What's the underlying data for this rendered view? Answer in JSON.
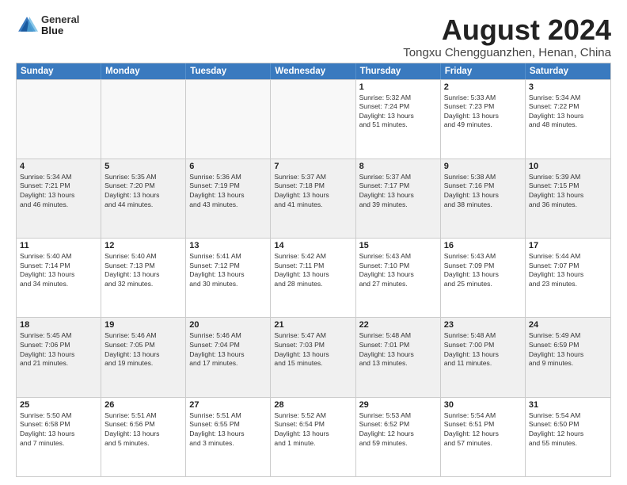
{
  "logo": {
    "line1": "General",
    "line2": "Blue"
  },
  "title": "August 2024",
  "location": "Tongxu Chengguanzhen, Henan, China",
  "header_days": [
    "Sunday",
    "Monday",
    "Tuesday",
    "Wednesday",
    "Thursday",
    "Friday",
    "Saturday"
  ],
  "rows": [
    [
      {
        "day": "",
        "empty": true
      },
      {
        "day": "",
        "empty": true
      },
      {
        "day": "",
        "empty": true
      },
      {
        "day": "",
        "empty": true
      },
      {
        "day": "1",
        "sunrise": "Sunrise: 5:32 AM",
        "sunset": "Sunset: 7:24 PM",
        "daylight": "Daylight: 13 hours",
        "daylight2": "and 51 minutes."
      },
      {
        "day": "2",
        "sunrise": "Sunrise: 5:33 AM",
        "sunset": "Sunset: 7:23 PM",
        "daylight": "Daylight: 13 hours",
        "daylight2": "and 49 minutes."
      },
      {
        "day": "3",
        "sunrise": "Sunrise: 5:34 AM",
        "sunset": "Sunset: 7:22 PM",
        "daylight": "Daylight: 13 hours",
        "daylight2": "and 48 minutes."
      }
    ],
    [
      {
        "day": "4",
        "sunrise": "Sunrise: 5:34 AM",
        "sunset": "Sunset: 7:21 PM",
        "daylight": "Daylight: 13 hours",
        "daylight2": "and 46 minutes."
      },
      {
        "day": "5",
        "sunrise": "Sunrise: 5:35 AM",
        "sunset": "Sunset: 7:20 PM",
        "daylight": "Daylight: 13 hours",
        "daylight2": "and 44 minutes."
      },
      {
        "day": "6",
        "sunrise": "Sunrise: 5:36 AM",
        "sunset": "Sunset: 7:19 PM",
        "daylight": "Daylight: 13 hours",
        "daylight2": "and 43 minutes."
      },
      {
        "day": "7",
        "sunrise": "Sunrise: 5:37 AM",
        "sunset": "Sunset: 7:18 PM",
        "daylight": "Daylight: 13 hours",
        "daylight2": "and 41 minutes."
      },
      {
        "day": "8",
        "sunrise": "Sunrise: 5:37 AM",
        "sunset": "Sunset: 7:17 PM",
        "daylight": "Daylight: 13 hours",
        "daylight2": "and 39 minutes."
      },
      {
        "day": "9",
        "sunrise": "Sunrise: 5:38 AM",
        "sunset": "Sunset: 7:16 PM",
        "daylight": "Daylight: 13 hours",
        "daylight2": "and 38 minutes."
      },
      {
        "day": "10",
        "sunrise": "Sunrise: 5:39 AM",
        "sunset": "Sunset: 7:15 PM",
        "daylight": "Daylight: 13 hours",
        "daylight2": "and 36 minutes."
      }
    ],
    [
      {
        "day": "11",
        "sunrise": "Sunrise: 5:40 AM",
        "sunset": "Sunset: 7:14 PM",
        "daylight": "Daylight: 13 hours",
        "daylight2": "and 34 minutes."
      },
      {
        "day": "12",
        "sunrise": "Sunrise: 5:40 AM",
        "sunset": "Sunset: 7:13 PM",
        "daylight": "Daylight: 13 hours",
        "daylight2": "and 32 minutes."
      },
      {
        "day": "13",
        "sunrise": "Sunrise: 5:41 AM",
        "sunset": "Sunset: 7:12 PM",
        "daylight": "Daylight: 13 hours",
        "daylight2": "and 30 minutes."
      },
      {
        "day": "14",
        "sunrise": "Sunrise: 5:42 AM",
        "sunset": "Sunset: 7:11 PM",
        "daylight": "Daylight: 13 hours",
        "daylight2": "and 28 minutes."
      },
      {
        "day": "15",
        "sunrise": "Sunrise: 5:43 AM",
        "sunset": "Sunset: 7:10 PM",
        "daylight": "Daylight: 13 hours",
        "daylight2": "and 27 minutes."
      },
      {
        "day": "16",
        "sunrise": "Sunrise: 5:43 AM",
        "sunset": "Sunset: 7:09 PM",
        "daylight": "Daylight: 13 hours",
        "daylight2": "and 25 minutes."
      },
      {
        "day": "17",
        "sunrise": "Sunrise: 5:44 AM",
        "sunset": "Sunset: 7:07 PM",
        "daylight": "Daylight: 13 hours",
        "daylight2": "and 23 minutes."
      }
    ],
    [
      {
        "day": "18",
        "sunrise": "Sunrise: 5:45 AM",
        "sunset": "Sunset: 7:06 PM",
        "daylight": "Daylight: 13 hours",
        "daylight2": "and 21 minutes."
      },
      {
        "day": "19",
        "sunrise": "Sunrise: 5:46 AM",
        "sunset": "Sunset: 7:05 PM",
        "daylight": "Daylight: 13 hours",
        "daylight2": "and 19 minutes."
      },
      {
        "day": "20",
        "sunrise": "Sunrise: 5:46 AM",
        "sunset": "Sunset: 7:04 PM",
        "daylight": "Daylight: 13 hours",
        "daylight2": "and 17 minutes."
      },
      {
        "day": "21",
        "sunrise": "Sunrise: 5:47 AM",
        "sunset": "Sunset: 7:03 PM",
        "daylight": "Daylight: 13 hours",
        "daylight2": "and 15 minutes."
      },
      {
        "day": "22",
        "sunrise": "Sunrise: 5:48 AM",
        "sunset": "Sunset: 7:01 PM",
        "daylight": "Daylight: 13 hours",
        "daylight2": "and 13 minutes."
      },
      {
        "day": "23",
        "sunrise": "Sunrise: 5:48 AM",
        "sunset": "Sunset: 7:00 PM",
        "daylight": "Daylight: 13 hours",
        "daylight2": "and 11 minutes."
      },
      {
        "day": "24",
        "sunrise": "Sunrise: 5:49 AM",
        "sunset": "Sunset: 6:59 PM",
        "daylight": "Daylight: 13 hours",
        "daylight2": "and 9 minutes."
      }
    ],
    [
      {
        "day": "25",
        "sunrise": "Sunrise: 5:50 AM",
        "sunset": "Sunset: 6:58 PM",
        "daylight": "Daylight: 13 hours",
        "daylight2": "and 7 minutes."
      },
      {
        "day": "26",
        "sunrise": "Sunrise: 5:51 AM",
        "sunset": "Sunset: 6:56 PM",
        "daylight": "Daylight: 13 hours",
        "daylight2": "and 5 minutes."
      },
      {
        "day": "27",
        "sunrise": "Sunrise: 5:51 AM",
        "sunset": "Sunset: 6:55 PM",
        "daylight": "Daylight: 13 hours",
        "daylight2": "and 3 minutes."
      },
      {
        "day": "28",
        "sunrise": "Sunrise: 5:52 AM",
        "sunset": "Sunset: 6:54 PM",
        "daylight": "Daylight: 13 hours",
        "daylight2": "and 1 minute."
      },
      {
        "day": "29",
        "sunrise": "Sunrise: 5:53 AM",
        "sunset": "Sunset: 6:52 PM",
        "daylight": "Daylight: 12 hours",
        "daylight2": "and 59 minutes."
      },
      {
        "day": "30",
        "sunrise": "Sunrise: 5:54 AM",
        "sunset": "Sunset: 6:51 PM",
        "daylight": "Daylight: 12 hours",
        "daylight2": "and 57 minutes."
      },
      {
        "day": "31",
        "sunrise": "Sunrise: 5:54 AM",
        "sunset": "Sunset: 6:50 PM",
        "daylight": "Daylight: 12 hours",
        "daylight2": "and 55 minutes."
      }
    ]
  ]
}
